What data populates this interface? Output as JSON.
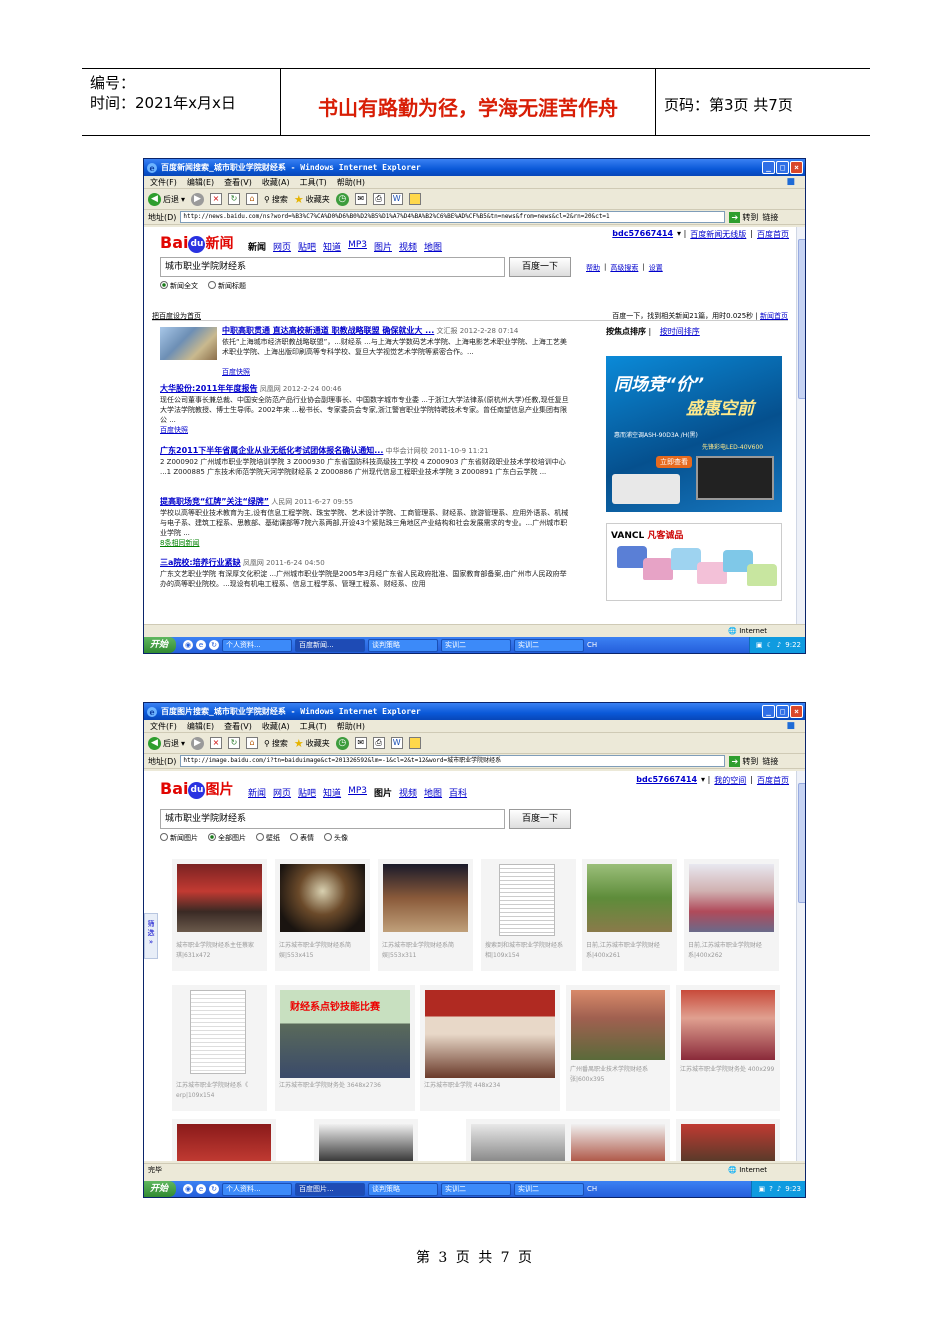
{
  "doc_header": {
    "code_label": "编号：",
    "date_label": "时间：2021年x月x日",
    "motto": "书山有路勤为径，学海无涯苦作舟",
    "page_label": "页码：第3页  共7页"
  },
  "footer": "第 3 页 共 7 页",
  "window1": {
    "title": "百度新闻搜索_城市职业学院财经系 - Windows Internet Explorer",
    "menus": [
      "文件(F)",
      "编辑(E)",
      "查看(V)",
      "收藏(A)",
      "工具(T)",
      "帮助(H)"
    ],
    "back_label": "后退",
    "search_label": "搜索",
    "favorites_label": "收藏夹",
    "address_label": "地址(D)",
    "address_url": "http://news.baidu.com/ns?word=%B3%C7%CA%D0%D6%B0%D2%B5%D1%A7%D4%BA%B2%C6%BE%AD%CF%B5&tn=news&from=news&cl=2&rn=20&ct=1",
    "go_label": "转到",
    "links_label": "链接",
    "status": "Internet",
    "clock": "9:22"
  },
  "news_page": {
    "logo_bai": "Bai",
    "logo_du": "du",
    "logo_channel": "新闻",
    "nav": [
      "新闻",
      "网页",
      "贴吧",
      "知道",
      "MP3",
      "图片",
      "视频",
      "地图"
    ],
    "user": [
      "bdc57667414",
      "百度新闻无线版",
      "百度首页"
    ],
    "keyword": "城市职业学院财经系",
    "search_button": "百度一下",
    "right_links": [
      "帮助",
      "高级搜索",
      "设置"
    ],
    "radios": [
      "新闻全文",
      "新闻标题"
    ],
    "set_home": "把百度设为首页",
    "result_stats": "百度一下，找到相关新闻21篇，用时0.025秒",
    "news_home": "新闻首页",
    "sort_label": "按焦点排序",
    "sort_time": "按时间排序",
    "ad1": {
      "line1": "同场竞“价”",
      "line2": "盛惠空前",
      "line3": "惠而浦空调ASH-90D3A /H(黑)",
      "line4": "先锋彩电LED-40V600",
      "button": "立即查看"
    },
    "ad2": {
      "brand": "VANCL",
      "name": "凡客诚品"
    },
    "results": [
      {
        "title": "中职高职贯通 直达高校新通道 职教战略联盟 确保就业大 ...",
        "source": "文汇报 2012-2-28 07:14",
        "snippet": "依托“上海城市经济职教战略联盟”，...财经系 ...与上海大学数码艺术学院、上海电影艺术职业学院、上海工艺美术职业学院、上海出版印刷高等专科学校、复旦大学视觉艺术学院等紧密合作。...",
        "more": "百度快照"
      },
      {
        "title": "大华股份:2011年年度报告",
        "source": "凤凰网 2012-2-24 00:46",
        "snippet": "现任公司董事长兼总裁、中国安全防范产品行业协会副理事长、中国数字城市专业委 ...于浙江大学法律系(原杭州大学)任教,现任复旦大学法学院教授、博士生导师。2002年来 ...秘书长、专家委员会专家,浙江警官职业学院特聘技术专家。曾任南望信息产业集团有限公 ...",
        "more": "百度快照"
      },
      {
        "title": "广东2011下半年省属企业从业无纸化考试团体报名确认通知...",
        "source": "中华会计网校 2011-10-9 11:21",
        "snippet": "2 Z000902 广州城市职业学院培训学院 3 Z000930 广东省国防科技高级技工学校 4 Z000903 广东省财政职业技术学校培训中心 ...1 Z000885 广东技术师范学院天河学院财经系 2 Z000886 广州现代信息工程职业技术学院 3 Z000891 广东白云学院 ...",
        "more": ""
      },
      {
        "title": "提高职场竞“红牌”关注“绿牌”",
        "source": "人民网 2011-6-27 09:55",
        "snippet": "学校以高等职业技术教育为主,设有信息工程学院、珠宝学院、艺术设计学院、工商管理系、财经系、旅游管理系、应用外语系、机械与电子系、建筑工程系、思教部、基础课部等7院六系两部,开设43个紧贴珠三角地区产业结构和社会发展需求的专业。...广州城市职业学院 ...",
        "more": "8条相同新闻"
      },
      {
        "title": "三a院校:培养行业紧缺",
        "source": "凤凰网 2011-6-24 04:50",
        "snippet": "广东文艺职业学院 有深厚文化积淀 ...广州城市职业学院是2005年3月经广东省人民政府批准、国家教育部备案,由广州市人民政府举办的高等职业院校。...现设有机电工程系、信息工程学系、管理工程系、财经系、应用",
        "more": ""
      }
    ]
  },
  "window2": {
    "title": "百度图片搜索_城市职业学院财经系 - Windows Internet Explorer",
    "menus": [
      "文件(F)",
      "编辑(E)",
      "查看(V)",
      "收藏(A)",
      "工具(T)",
      "帮助(H)"
    ],
    "back_label": "后退",
    "search_label": "搜索",
    "favorites_label": "收藏夹",
    "address_label": "地址(D)",
    "address_url": "http://image.baidu.com/i?tn=baiduimage&ct=201326592&lm=-1&cl=2&t=12&word=城市职业学院财经系",
    "go_label": "转到",
    "links_label": "链接",
    "status": "完毕",
    "status_right": "Internet",
    "clock": "9:23"
  },
  "image_page": {
    "logo_bai": "Bai",
    "logo_du": "du",
    "logo_channel": "图片",
    "nav": [
      "新闻",
      "网页",
      "贴吧",
      "知道",
      "MP3",
      "图片",
      "视频",
      "地图",
      "百科"
    ],
    "user": [
      "bdc57667414",
      "我的空间",
      "百度首页"
    ],
    "keyword": "城市职业学院财经系",
    "search_button": "百度一下",
    "radios": [
      "新闻图片",
      "全部图片",
      "壁纸",
      "表情",
      "头像"
    ],
    "filter_tab": "筛选",
    "cards_row1": [
      {
        "cap": "城市职业学院财经系主任蔡家琪|631x472"
      },
      {
        "cap": "江苏城市职业学院财经系简娱|553x415"
      },
      {
        "cap": "江苏城市职业学院财经系简娱|553x311"
      },
      {
        "cap": "搜索到和城市职业学院财经系相|109x154"
      },
      {
        "cap": "日前,江苏城市职业学院财经系|400x261"
      },
      {
        "cap": "日前,江苏城市职业学院财经系|400x262"
      }
    ],
    "cards_row2": [
      {
        "cap": "江苏城市职业学院财经系《 erp|109x154"
      },
      {
        "cap": "江苏城市职业学院财务处 3648x2736",
        "banner": "财经系点钞技能比赛"
      },
      {
        "cap": "江苏城市职业学院 448x234"
      },
      {
        "cap": "广州番禺职业技术学院财经系张|600x395"
      },
      {
        "cap": "江苏城市职业学院财务处 400x299"
      }
    ]
  },
  "taskbar": {
    "start": "开始",
    "tasks1": [
      "个人资料...",
      "百度新闻...",
      "谈判策略",
      "实训二",
      "实训二"
    ],
    "tasks2": [
      "个人资料...",
      "百度图片...",
      "谈判策略",
      "实训二",
      "实训二"
    ],
    "ime": "CH"
  }
}
